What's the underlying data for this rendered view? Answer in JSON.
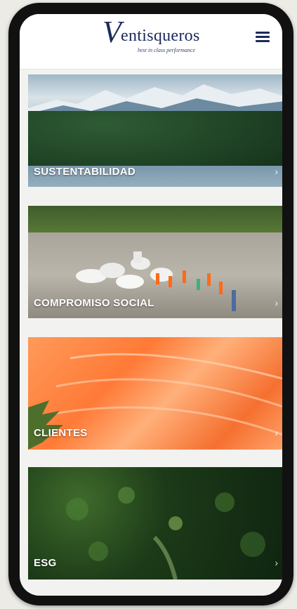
{
  "header": {
    "logo_initial": "V",
    "logo_text": "entisqueros",
    "logo_tagline": "best in class performance",
    "menu_icon": "hamburger-menu-icon"
  },
  "cards": [
    {
      "label": "SUSTENTABILIDAD",
      "chevron": "›"
    },
    {
      "label": "COMPROMISO SOCIAL",
      "chevron": "›"
    },
    {
      "label": "CLIENTES",
      "chevron": "›"
    },
    {
      "label": "ESG",
      "chevron": "›"
    }
  ],
  "colors": {
    "brand_navy": "#1d2a5a",
    "frame": "#111111",
    "page_bg": "#ecebe6"
  }
}
